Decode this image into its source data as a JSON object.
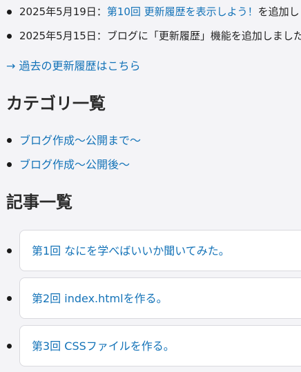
{
  "updates": [
    {
      "date": "2025年5月19日：",
      "link": "第10回 更新履歴を表示しよう！",
      "suffix": "を追加しました"
    },
    {
      "date": "2025年5月15日：",
      "link": "",
      "suffix": "ブログに「更新履歴」機能を追加しました"
    }
  ],
  "past_updates_link": "→ 過去の更新履歴はこちら",
  "category_section": {
    "heading": "カテゴリ一覧",
    "items": [
      "ブログ作成〜公開まで〜",
      "ブログ作成〜公開後〜"
    ]
  },
  "article_section": {
    "heading": "記事一覧",
    "items": [
      "第1回 なにを学べばいいか聞いてみた。",
      "第2回 index.htmlを作る。",
      "第3回 CSSファイルを作る。"
    ]
  },
  "colors": {
    "link": "#1473b8",
    "background": "#f4f4f7",
    "card_border": "#d9d9de"
  }
}
